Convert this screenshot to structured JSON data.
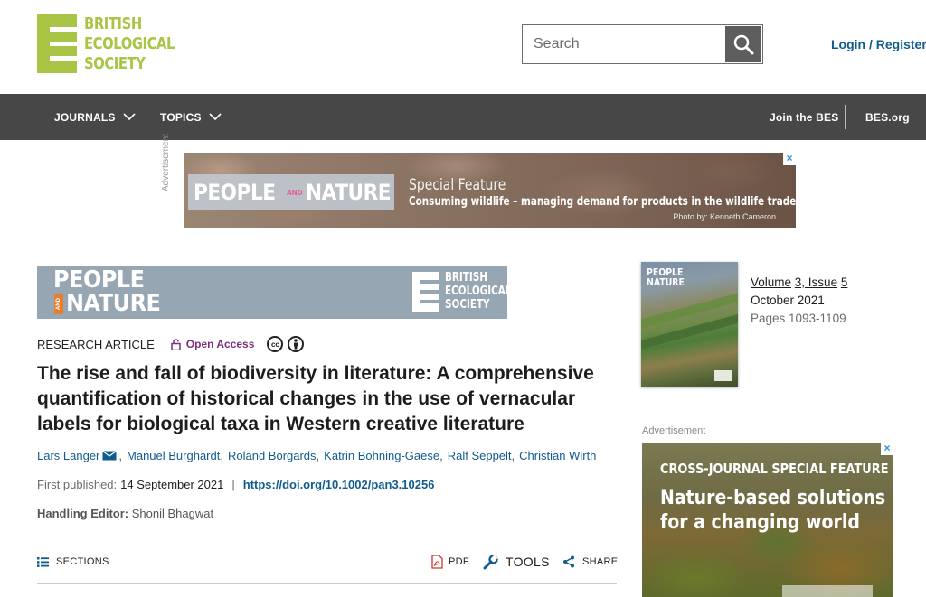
{
  "header": {
    "logo": {
      "line1": "BRITISH",
      "line2": "ECOLOGICAL",
      "line3": "SOCIETY"
    },
    "search": {
      "placeholder": "Search",
      "icon": "search-icon"
    },
    "login_label": "Login / Register"
  },
  "nav": {
    "items": [
      {
        "label": "JOURNALS",
        "icon": "chevron-down-icon"
      },
      {
        "label": "TOPICS",
        "icon": "chevron-down-icon"
      }
    ],
    "right": [
      {
        "label": "Join the BES"
      },
      {
        "label": "BES.org"
      }
    ]
  },
  "banner_ad": {
    "vertical_label": "Advertisement",
    "brand_left": "PEOPLE",
    "brand_and": "AND",
    "brand_right": "NATURE",
    "headline": "Special Feature",
    "subline": "Consuming wildlife – managing demand for products in the wildlife trade",
    "photo_credit": "Photo by: Kenneth Cameron",
    "close": "×"
  },
  "journal_banner": {
    "people": "PEOPLE",
    "and": "AND",
    "nature": "NATURE",
    "bes_line1": "BRITISH",
    "bes_line2": "ECOLOGICAL",
    "bes_line3": "SOCIETY"
  },
  "article": {
    "type": "RESEARCH ARTICLE",
    "access": "Open Access",
    "license_icons": [
      "cc-icon",
      "by-icon"
    ],
    "title": "The rise and fall of biodiversity in literature: A comprehensive quantification of historical changes in the use of vernacular labels for biological taxa in Western creative literature",
    "authors": [
      "Lars Langer",
      "Manuel Burghardt",
      "Roland Borgards",
      "Katrin Böhning-Gaese",
      "Ralf Seppelt",
      "Christian Wirth"
    ],
    "first_published_label": "First published:",
    "first_published_date": "14 September 2021",
    "separator": "|",
    "doi": "https://doi.org/10.1002/pan3.10256",
    "editor_label": "Handling Editor:",
    "editor_name": "Shonil Bhagwat"
  },
  "toolbar": {
    "sections": "SECTIONS",
    "pdf": "PDF",
    "tools": "TOOLS",
    "share": "SHARE"
  },
  "issue": {
    "cover_title_1": "PEOPLE",
    "cover_title_2": "NATURE",
    "volume": "Volume",
    "volume_num": "3, Issue",
    "issue_num": "5",
    "date": "October 2021",
    "pages": "Pages 1093-1109"
  },
  "side_ad": {
    "label": "Advertisement",
    "head": "CROSS-JOURNAL SPECIAL FEATURE",
    "title_line1": "Nature-based solutions",
    "title_line2": "for a changing world",
    "close": "×"
  },
  "colors": {
    "brand_green": "#a8c545",
    "nav_bg": "#474747",
    "link_blue": "#115c8f",
    "open_access_purple": "#7b2f7e"
  }
}
